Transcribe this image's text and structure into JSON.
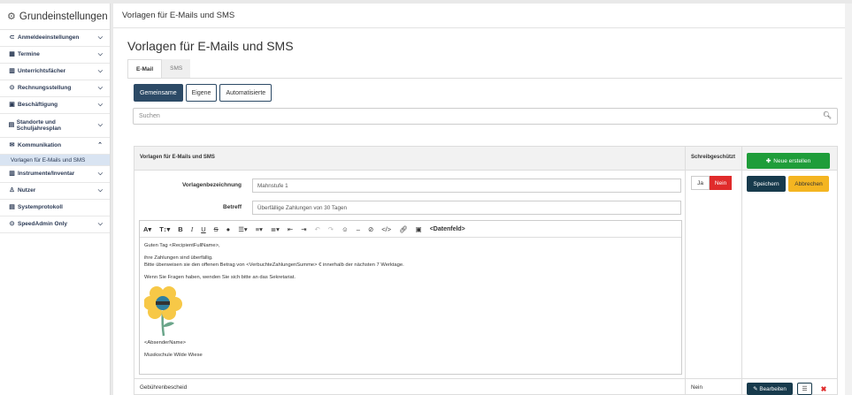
{
  "sidebar": {
    "title": "Grundeinstellungen",
    "title_icon": "gear-icon",
    "items": [
      {
        "label": "Anmeldeeinstellungen",
        "icon": "⊂"
      },
      {
        "label": "Termine",
        "icon": "▦"
      },
      {
        "label": "Unterrichtsfächer",
        "icon": "▥"
      },
      {
        "label": "Rechnungsstellung",
        "icon": "⊙"
      },
      {
        "label": "Beschäftigung",
        "icon": "▣"
      },
      {
        "label": "Standorte und Schuljahresplan",
        "icon": "▤"
      },
      {
        "label": "Kommunikation",
        "icon": "✉"
      },
      {
        "label": "Instrumente/Inventar",
        "icon": "▥"
      },
      {
        "label": "Nutzer",
        "icon": "♙"
      },
      {
        "label": "Systemprotokoll",
        "icon": "▤"
      },
      {
        "label": "SpeedAdmin Only",
        "icon": "⊙"
      }
    ],
    "sub_item": "Vorlagen für E-Mails und SMS"
  },
  "topbar": {
    "title": "Vorlagen für E-Mails und SMS"
  },
  "page": {
    "title": "Vorlagen für E-Mails und SMS"
  },
  "tabs": [
    "E-Mail",
    "SMS"
  ],
  "filters": [
    "Gemeinsame",
    "Eigene",
    "Automatisierte"
  ],
  "search": {
    "placeholder": "Suchen"
  },
  "table": {
    "col1": "Vorlagen für E-Mails und SMS",
    "col2": "Schreibgeschützt",
    "new_button": "Neue erstellen",
    "form": {
      "name_label": "Vorlagenbezeichnung",
      "name_value": "Mahnstufe 1",
      "subject_label": "Betreff",
      "subject_value": "Überfällige Zahlungen von 30 Tagen",
      "ja": "Ja",
      "nein": "Nein",
      "save": "Speichern",
      "cancel": "Abbrechen"
    },
    "editor": {
      "datenfeld": "<Datenfeld>",
      "line1": "Guten Tag <RecipientFullName>,",
      "line2": "ihre Zahlungen sind überfällig.",
      "line3": "Bitte überweisen sie den offenen Betrag von <VerbuchteZahlungenSumme> € innerhalb der nächsten 7 Werktage.",
      "line4": "Wenn Sie Fragen haben, wenden Sie sich bitte an das Sekretariat.",
      "line5": "<AbsenderName>",
      "line6": "Musikschule Wilde Wiese"
    },
    "row2": {
      "name": "Gebührenbescheid",
      "readonly": "Nein",
      "edit": "Bearbeiten"
    }
  },
  "colors": {
    "primary": "#173a4c",
    "success": "#1f9d3a",
    "danger": "#e02b2b",
    "warning": "#f4b521"
  }
}
